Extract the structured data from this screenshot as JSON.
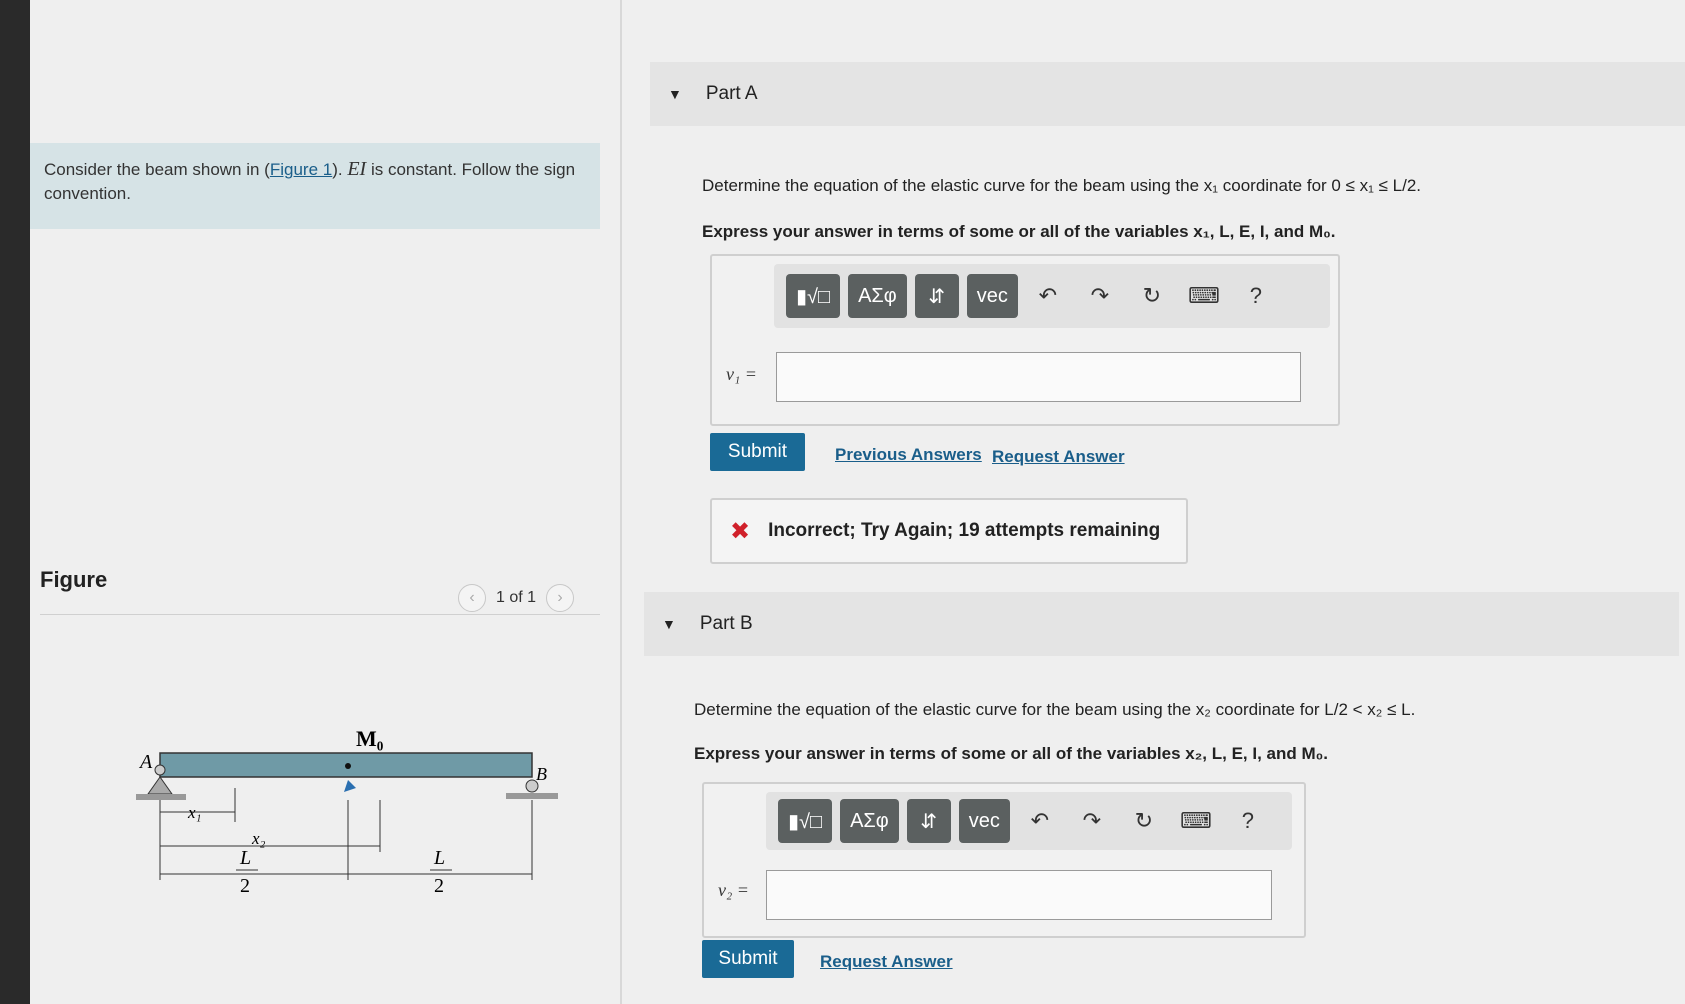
{
  "problem": {
    "text_before": "Consider the beam shown in (",
    "figure_link": "Figure 1",
    "text_mid": "). ",
    "ei": "EI",
    "text_after": " is constant. Follow the sign convention."
  },
  "figure": {
    "title": "Figure",
    "pager": "1 of 1",
    "labels": {
      "A": "A",
      "B": "B",
      "M0": "M₀",
      "x1": "x₁",
      "x2": "x₂",
      "L": "L",
      "two": "2"
    }
  },
  "toolbar": {
    "templates": "▮√□",
    "greek": "ΑΣφ",
    "arrows": "⇵",
    "vec": "vec",
    "help": "?"
  },
  "partA": {
    "title": "Part A",
    "prompt": "Determine the equation of the elastic curve for the beam using the x₁ coordinate for 0 ≤ x₁ ≤ L/2.",
    "express": "Express your answer in terms of some or all of the variables x₁, L, E, I, and M₀.",
    "label": "v₁ =",
    "input_value": "",
    "submit": "Submit",
    "previous_answers": "Previous Answers",
    "request_answer": "Request Answer",
    "feedback": "Incorrect; Try Again; 19 attempts remaining",
    "feedback_icon": "✖"
  },
  "partB": {
    "title": "Part B",
    "prompt": "Determine the equation of the elastic curve for the beam using the x₂ coordinate for L/2 < x₂ ≤ L.",
    "express": "Express your answer in terms of some or all of the variables x₂, L, E, I, and M₀.",
    "label": "v₂ =",
    "input_value": "",
    "submit": "Submit",
    "request_answer": "Request Answer"
  },
  "colors": {
    "accent": "#1a6a96",
    "problem_bg": "#d6e3e6",
    "error": "#d0202a",
    "beam": "#6f9aa6"
  }
}
